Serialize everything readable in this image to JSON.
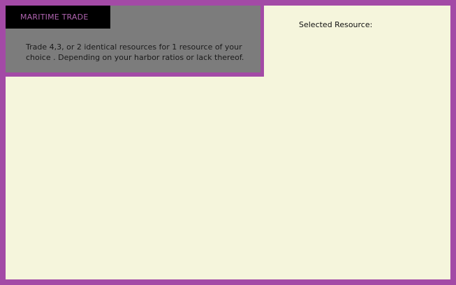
{
  "panel": {
    "title": "MARITIME TRADE",
    "description": "Trade 4,3, or 2 identical resources for 1 resource of your choice . Depending on your harbor ratios or lack thereof."
  },
  "selection": {
    "label": "Selected Resource:"
  },
  "colors": {
    "frame": "#a34aa6",
    "background": "#f5f5dc",
    "info_panel": "#7c7c7c",
    "title_box": "#000000",
    "title_text": "#b064b0"
  }
}
